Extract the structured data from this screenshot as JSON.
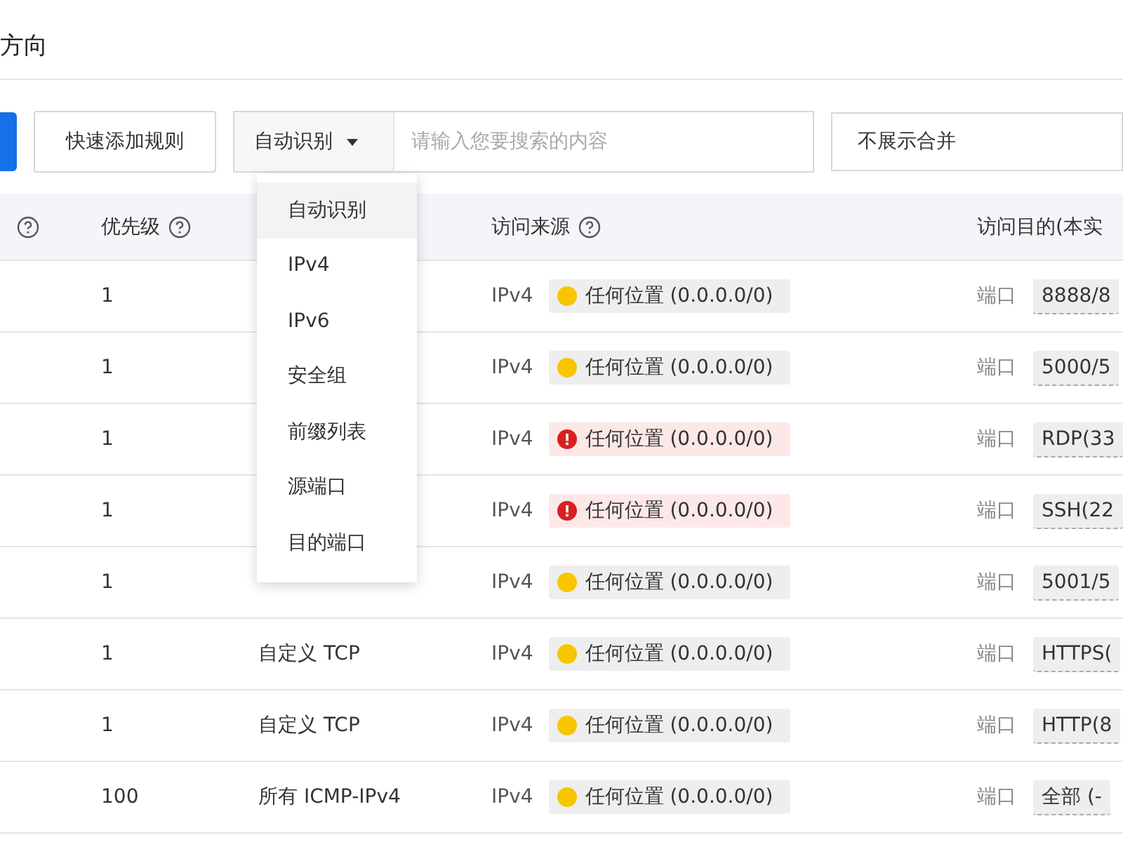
{
  "page_title": "方向",
  "toolbar": {
    "quick_add_button": "快速添加规则",
    "search_type": {
      "value": "自动识别",
      "expanded": true
    },
    "search": {
      "placeholder": "请输入您要搜索的内容"
    },
    "merge_select": "不展示合并"
  },
  "dropdown": {
    "options": [
      {
        "label": "自动识别",
        "selected": true
      },
      {
        "label": "IPv4",
        "selected": false
      },
      {
        "label": "IPv6",
        "selected": false
      },
      {
        "label": "安全组",
        "selected": false
      },
      {
        "label": "前缀列表",
        "selected": false
      },
      {
        "label": "源端口",
        "selected": false
      },
      {
        "label": "目的端口",
        "selected": false
      }
    ]
  },
  "table": {
    "columns": [
      {
        "help": true
      },
      {
        "label": "优先级",
        "help": true
      },
      {
        "label": "访问来源",
        "help": true
      },
      {
        "label": "访问目的(本实",
        "help": false
      }
    ],
    "rows": [
      {
        "priority": "1",
        "ip_version": "IPv4",
        "source": {
          "kind": "warning",
          "text": "任何位置 (0.0.0.0/0)"
        },
        "dest_label": "端口",
        "dest": "8888/8"
      },
      {
        "priority": "1",
        "ip_version": "IPv4",
        "source": {
          "kind": "warning",
          "text": "任何位置 (0.0.0.0/0)"
        },
        "dest_label": "端口",
        "dest": "5000/5"
      },
      {
        "priority": "1",
        "ip_version": "IPv4",
        "source": {
          "kind": "danger",
          "text": "任何位置 (0.0.0.0/0)"
        },
        "dest_label": "端口",
        "dest": "RDP(33"
      },
      {
        "priority": "1",
        "ip_version": "IPv4",
        "source": {
          "kind": "danger",
          "text": "任何位置 (0.0.0.0/0)"
        },
        "dest_label": "端口",
        "dest": "SSH(22"
      },
      {
        "priority": "1",
        "ip_version": "IPv4",
        "source": {
          "kind": "warning",
          "text": "任何位置 (0.0.0.0/0)"
        },
        "dest_label": "端口",
        "dest": "5001/5"
      },
      {
        "priority": "1",
        "protocol": "自定义 TCP",
        "ip_version": "IPv4",
        "source": {
          "kind": "warning",
          "text": "任何位置 (0.0.0.0/0)"
        },
        "dest_label": "端口",
        "dest": "HTTPS("
      },
      {
        "priority": "1",
        "protocol": "自定义 TCP",
        "ip_version": "IPv4",
        "source": {
          "kind": "warning",
          "text": "任何位置 (0.0.0.0/0)"
        },
        "dest_label": "端口",
        "dest": "HTTP(8"
      },
      {
        "priority": "100",
        "protocol": "所有 ICMP-IPv4",
        "ip_version": "IPv4",
        "source": {
          "kind": "warning",
          "text": "任何位置 (0.0.0.0/0)"
        },
        "dest_label": "端口",
        "dest": "全部 (-"
      }
    ]
  }
}
